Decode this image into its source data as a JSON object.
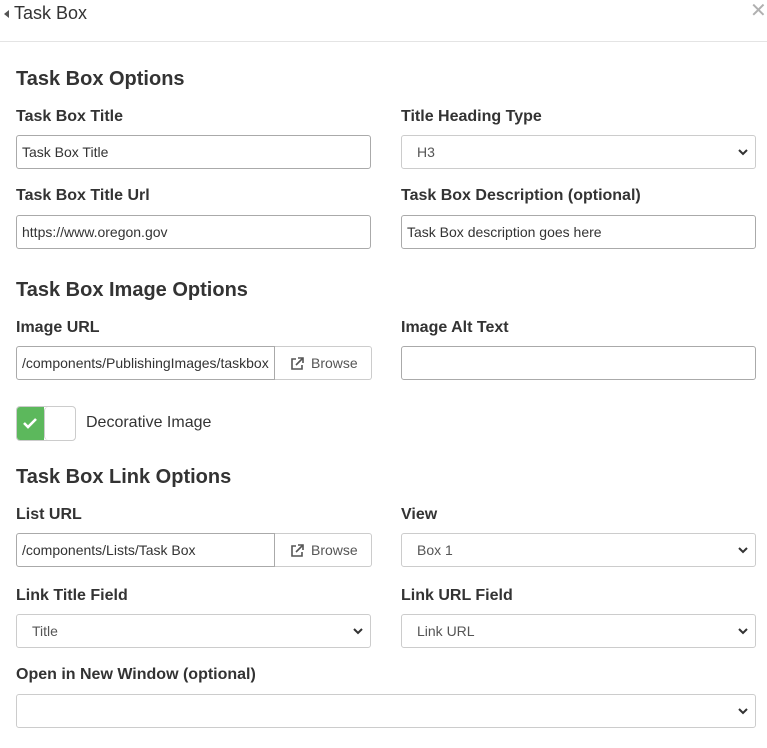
{
  "header": {
    "title": "Task Box"
  },
  "options": {
    "section_title": "Task Box Options",
    "title_label": "Task Box Title",
    "title_value": "Task Box Title",
    "heading_label": "Title Heading Type",
    "heading_value": "H3",
    "url_label": "Task Box Title Url",
    "url_value": "https://www.oregon.gov",
    "desc_label": "Task Box Description (optional)",
    "desc_value": "Task Box description goes here"
  },
  "image": {
    "section_title": "Task Box Image Options",
    "url_label": "Image URL",
    "url_value": "/components/PublishingImages/taskbox",
    "browse_label": "Browse",
    "alt_label": "Image Alt Text",
    "alt_value": "",
    "decorative_label": "Decorative Image",
    "decorative_checked": true
  },
  "link": {
    "section_title": "Task Box Link Options",
    "list_label": "List URL",
    "list_value": "/components/Lists/Task Box",
    "browse_label": "Browse",
    "view_label": "View",
    "view_value": "Box 1",
    "title_field_label": "Link Title Field",
    "title_field_value": "Title",
    "url_field_label": "Link URL Field",
    "url_field_value": "Link URL",
    "new_window_label": "Open in New Window (optional)",
    "new_window_value": ""
  },
  "colors": {
    "toggle_on": "#5cb85c",
    "border": "#cccccc"
  }
}
